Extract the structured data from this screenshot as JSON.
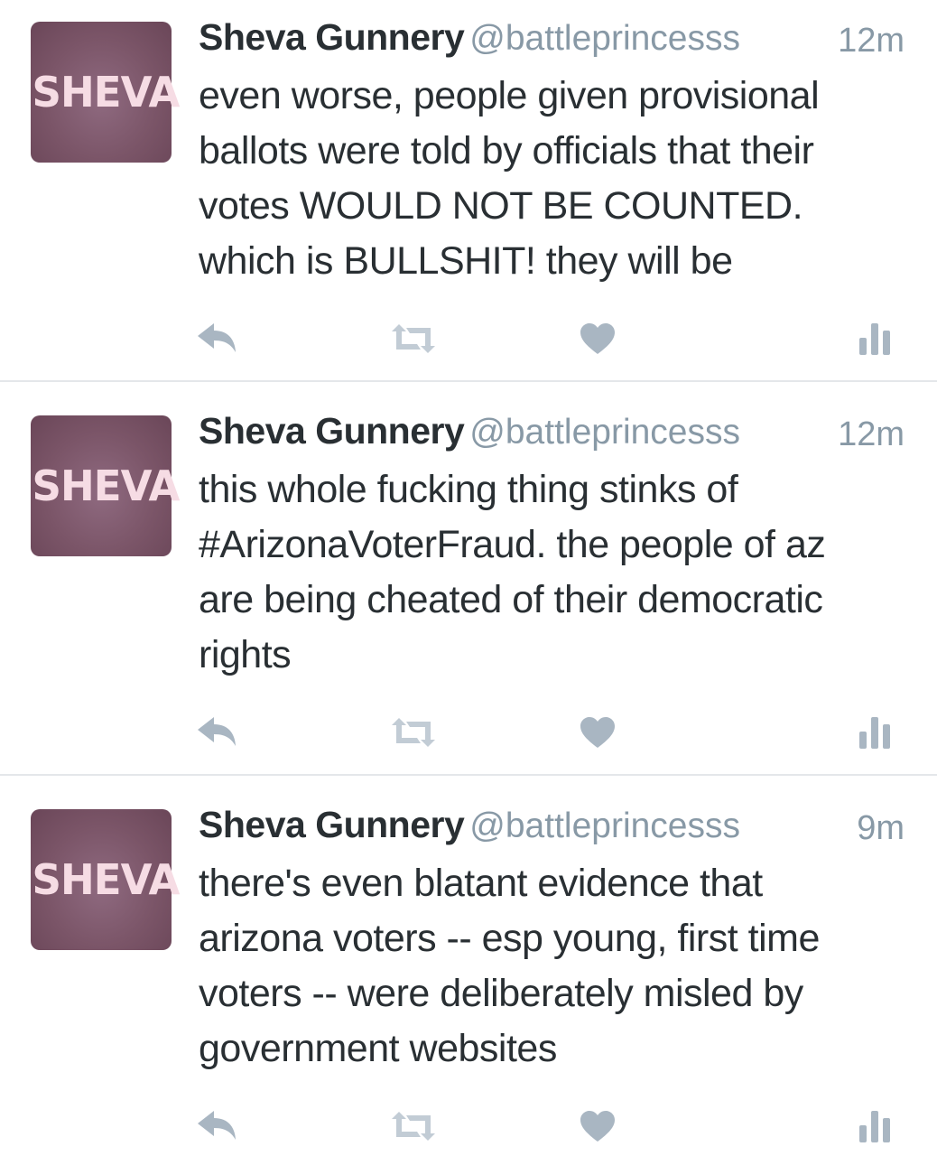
{
  "tweets": [
    {
      "avatar_text": "SHEVA",
      "name": "Sheva Gunnery",
      "handle": "@battleprincesss",
      "time": "12m",
      "lines": [
        "even worse, people given provisional",
        "ballots were told by officials that their",
        "votes WOULD NOT BE COUNTED.",
        "which is BULLSHIT! they will be"
      ]
    },
    {
      "avatar_text": "SHEVA",
      "name": "Sheva Gunnery",
      "handle": "@battleprincesss",
      "time": "12m",
      "lines": [
        "this whole fucking thing stinks of",
        "#ArizonaVoterFraud. the people of az",
        "are being cheated of their democratic",
        "rights"
      ]
    },
    {
      "avatar_text": "SHEVA",
      "name": "Sheva Gunnery",
      "handle": "@battleprincesss",
      "time": "9m",
      "lines": [
        "there's even blatant evidence that",
        "arizona voters -- esp young, first time",
        "voters -- were deliberately misled by",
        "government websites"
      ]
    }
  ],
  "icons": {
    "reply": "reply-icon",
    "retweet": "retweet-icon",
    "like": "heart-icon",
    "stats": "analytics-icon"
  },
  "colors": {
    "icon": "#a9b6c2",
    "name": "#292f33",
    "secondary": "#8899a6",
    "avatar": "#7b5568",
    "avatar_text": "#f6dce4"
  }
}
